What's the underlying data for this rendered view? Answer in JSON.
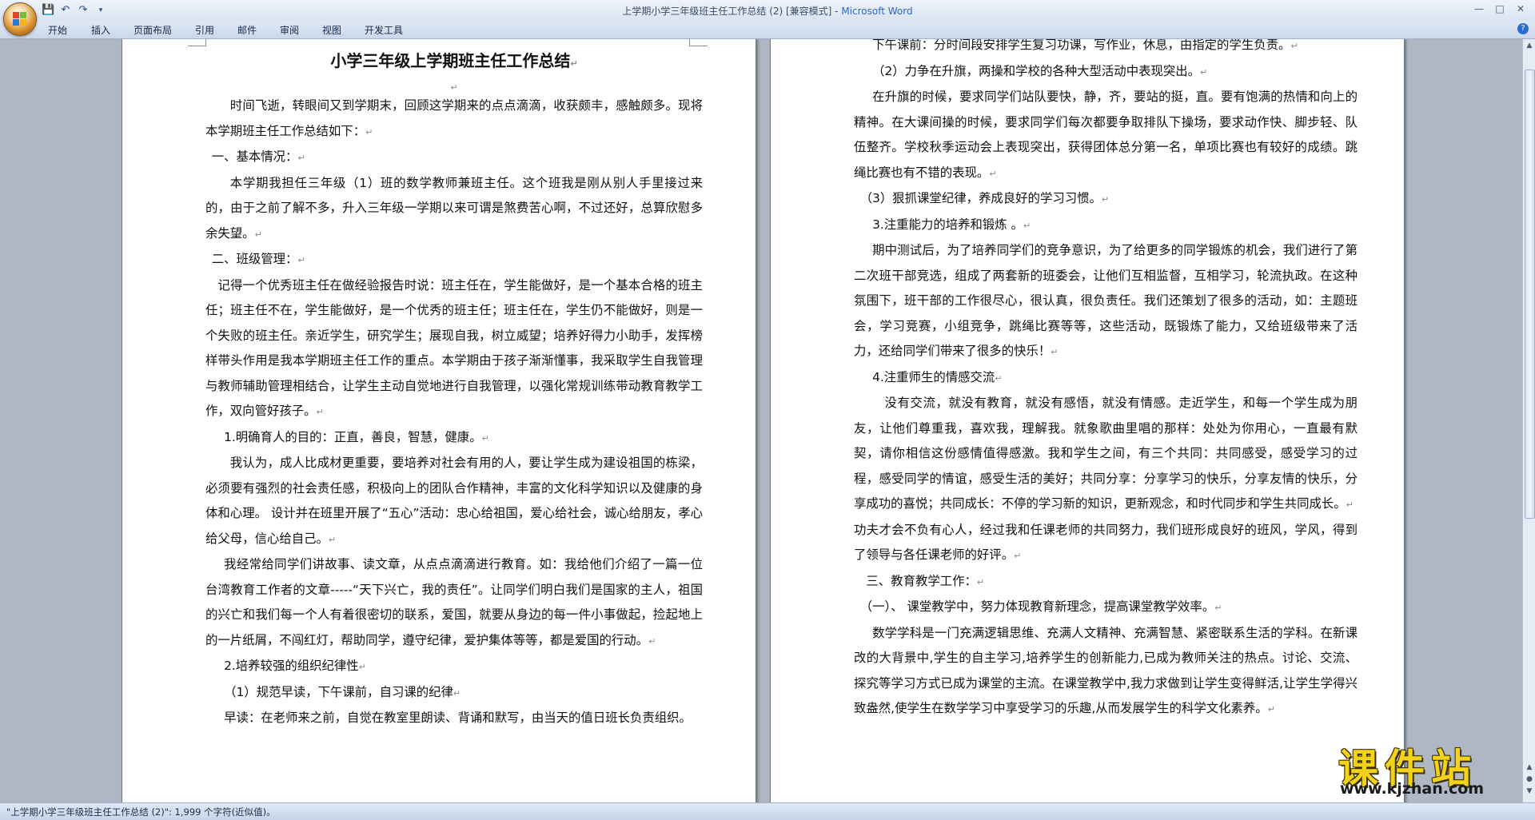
{
  "window": {
    "title": "上学期小学三年级班主任工作总结 (2) [兼容模式] - ",
    "app_name": "Microsoft Word"
  },
  "ribbon": {
    "tabs": [
      {
        "label": "开始"
      },
      {
        "label": "插入"
      },
      {
        "label": "页面布局"
      },
      {
        "label": "引用"
      },
      {
        "label": "邮件"
      },
      {
        "label": "审阅"
      },
      {
        "label": "视图"
      },
      {
        "label": "开发工具"
      }
    ]
  },
  "doc": {
    "title": "小学三年级上学期班主任工作总结",
    "page1": [
      "时间飞逝，转眼间又到学期末，回顾这学期来的点点滴滴，收获颇丰，感触颇多。现将本学期班主任工作总结如下：",
      "一、基本情况：",
      "本学期我担任三年级（1）班的数学教师兼班主任。这个班我是刚从别人手里接过来的，由于之前了解不多，升入三年级一学期以来可谓是煞费苦心啊，不过还好，总算欣慰多余失望。",
      "二、班级管理：",
      "记得一个优秀班主任在做经验报告时说：班主任在，学生能做好，是一个基本合格的班主任；班主任不在，学生能做好，是一个优秀的班主任；班主任在，学生仍不能做好，则是一个失败的班主任。亲近学生，研究学生；展现自我，树立威望；培养好得力小助手，发挥榜样带头作用是我本学期班主任工作的重点。本学期由于孩子渐渐懂事，我采取学生自我管理与教师辅助管理相结合，让学生主动自觉地进行自我管理，以强化常规训练带动教育教学工作，双向管好孩子。",
      "1.明确育人的目的：正直，善良，智慧，健康。",
      "我认为，成人比成材更重要，要培养对社会有用的人，要让学生成为建设祖国的栋梁，必须要有强烈的社会责任感，积极向上的团队合作精神，丰富的文化科学知识以及健康的身体和心理。  设计并在班里开展了“五心”活动：忠心给祖国，爱心给社会，诚心给朋友，孝心给父母，信心给自己。",
      "我经常给同学们讲故事、读文章，从点点滴滴进行教育。如：我给他们介绍了一篇一位台湾教育工作者的文章-----“天下兴亡，我的责任”。让同学们明白我们是国家的主人，祖国的兴亡和我们每一个人有着很密切的联系，爱国，就要从身边的每一件小事做起，捡起地上的一片纸屑，不闯红灯，帮助同学，遵守纪律，爱护集体等等，都是爱国的行动。",
      "2.培养较强的组织纪律性",
      "（1）规范早读，下午课前，自习课的纪律",
      "早读：在老师来之前，自觉在教室里朗读、背诵和默写，由当天的值日班长负责组织。"
    ],
    "page2": [
      "下午课前：分时间段安排学生复习功课，写作业，休息，由指定的学生负责。",
      "（2）力争在升旗，两操和学校的各种大型活动中表现突出。",
      "在升旗的时候，要求同学们站队要快，静，齐，要站的挺，直。要有饱满的热情和向上的精神。在大课间操的时候，要求同学们每次都要争取排队下操场，要求动作快、脚步轻、队伍整齐。学校秋季运动会上表现突出，获得团体总分第一名，单项比赛也有较好的成绩。跳绳比赛也有不错的表现。",
      "（3）狠抓课堂纪律，养成良好的学习习惯。",
      "3.注重能力的培养和锻炼 。",
      "期中测试后，为了培养同学们的竞争意识，为了给更多的同学锻炼的机会，我们进行了第二次班干部竞选，组成了两套新的班委会，让他们互相监督，互相学习，轮流执政。在这种氛围下，班干部的工作很尽心，很认真，很负责任。我们还策划了很多的活动，如：主题班会，学习竞赛，小组竞争，跳绳比赛等等，这些活动，既锻炼了能力，又给班级带来了活力，还给同学们带来了很多的快乐！",
      "4.注重师生的情感交流",
      "没有交流，就没有教育，就没有感悟，就没有情感。走近学生，和每一个学生成为朋友，让他们尊重我，喜欢我，理解我。就象歌曲里唱的那样：处处为你用心，一直最有默契，请你相信这份感情值得感激。我和学生之间，有三个共同：共同感受，感受学习的过程，感受同学的情谊，感受生活的美好；共同分享：分享学习的快乐，分享友情的快乐，分享成功的喜悦；共同成长：不停的学习新的知识，更新观念，和时代同步和学生共同成长。",
      "功夫才会不负有心人，经过我和任课老师的共同努力，我们班形成良好的班风，学风，得到了领导与各任课老师的好评。",
      "三、教育教学工作：",
      "（一）、 课堂教学中，努力体现教育新理念，提高课堂教学效率。",
      "数学学科是一门充满逻辑思维、充满人文精神、充满智慧、紧密联系生活的学科。在新课改的大背景中,学生的自主学习,培养学生的创新能力,已成为教师关注的热点。讨论、交流、探究等学习方式已成为课堂的主流。在课堂教学中,我力求做到让学生变得鲜活,让学生学得兴致盎然,使学生在数学学习中享受学习的乐趣,从而发展学生的科学文化素养。"
    ]
  },
  "status": {
    "text": "\"上学期小学三年级班主任工作总结 (2)\": 1,999 个字符(近似值)。"
  },
  "watermark": {
    "brand": "课件站",
    "url": "www.kjzhan.com"
  },
  "colors": {
    "brand_blue": "#2a67c4",
    "watermark_yellow": "#f2d21b"
  }
}
